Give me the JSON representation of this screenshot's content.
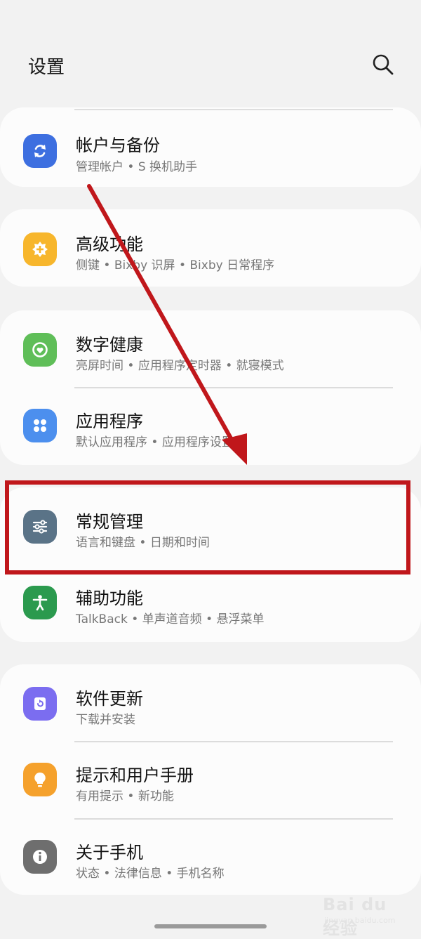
{
  "header": {
    "title": "设置",
    "search_icon": "search-icon"
  },
  "groups": [
    {
      "items": [
        {
          "title": "帐户与备份",
          "subtitle": "管理帐户 • S 换机助手",
          "icon": "sync-icon",
          "color": "#3d6fe0"
        }
      ]
    },
    {
      "items": [
        {
          "title": "高级功能",
          "subtitle": "侧键 • Bixby 识屏 • Bixby 日常程序",
          "icon": "advanced-features-icon",
          "color": "#f7b62c"
        }
      ]
    },
    {
      "items": [
        {
          "title": "数字健康",
          "subtitle": "亮屏时间 • 应用程序定时器 • 就寝模式",
          "icon": "digital-wellbeing-icon",
          "color": "#5fbe58"
        },
        {
          "title": "应用程序",
          "subtitle": "默认应用程序 • 应用程序设置",
          "icon": "apps-icon",
          "color": "#4c8fee"
        }
      ]
    },
    {
      "items": [
        {
          "title": "常规管理",
          "subtitle": "语言和键盘 • 日期和时间",
          "icon": "sliders-icon",
          "color": "#5a7387"
        },
        {
          "title": "辅助功能",
          "subtitle": "TalkBack • 单声道音频 • 悬浮菜单",
          "icon": "accessibility-icon",
          "color": "#2b9a4e"
        }
      ]
    },
    {
      "items": [
        {
          "title": "软件更新",
          "subtitle": "下载并安装",
          "icon": "software-update-icon",
          "color": "#7b6df0"
        },
        {
          "title": "提示和用户手册",
          "subtitle": "有用提示 • 新功能",
          "icon": "tips-bulb-icon",
          "color": "#f5a12c"
        },
        {
          "title": "关于手机",
          "subtitle": "状态 • 法律信息 • 手机名称",
          "icon": "info-icon",
          "color": "#6e6e6e"
        }
      ]
    }
  ],
  "annotation": {
    "arrow_color": "#c0171b",
    "box_color": "#c0171b"
  },
  "watermark": {
    "text": "Bai du 经验",
    "subtext": "jingyan.baidu.com"
  }
}
